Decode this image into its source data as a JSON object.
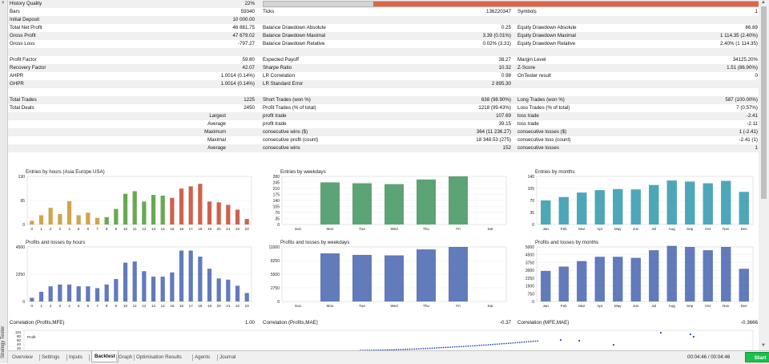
{
  "sidebar": {
    "vertical_label": "Strategy Tester",
    "close_glyph": "×"
  },
  "summary": {
    "progress_percent": 22,
    "rows": [
      {
        "alt": true,
        "cols": [
          [
            "History Quality",
            "22%"
          ],
          [
            "",
            ""
          ],
          [
            "",
            ""
          ]
        ]
      },
      {
        "alt": false,
        "cols": [
          [
            "Bars",
            "59340"
          ],
          [
            "Ticks",
            "136220347"
          ],
          [
            "Symbols",
            "1"
          ]
        ]
      },
      {
        "alt": true,
        "cols": [
          [
            "Initial Deposit",
            "10 000.00"
          ],
          [
            "",
            ""
          ],
          [
            "",
            ""
          ]
        ]
      },
      {
        "alt": false,
        "cols": [
          [
            "Total Net Profit",
            "46 881.75"
          ],
          [
            "Balance Drawdown Absolute",
            "0.25"
          ],
          [
            "Equity Drawdown Absolute",
            "66.89"
          ]
        ]
      },
      {
        "alt": true,
        "cols": [
          [
            "Gross Profit",
            "47 679.02"
          ],
          [
            "Balance Drawdown Maximal",
            "3.39 (0.01%)"
          ],
          [
            "Equity Drawdown Maximal",
            "1 114.35 (2.40%)"
          ]
        ]
      },
      {
        "alt": false,
        "cols": [
          [
            "Gross Loss",
            "-797.27"
          ],
          [
            "Balance Drawdown Relative",
            "0.02% (3.31)"
          ],
          [
            "Equity Drawdown Relative",
            "2.40% (1 114.35)"
          ]
        ]
      },
      {
        "alt": true,
        "cols": [
          [
            "",
            ""
          ],
          [
            "",
            ""
          ],
          [
            "",
            ""
          ]
        ]
      },
      {
        "alt": false,
        "cols": [
          [
            "Profit Factor",
            "59.80"
          ],
          [
            "Expected Payoff",
            "38.27"
          ],
          [
            "Margin Level",
            "34125.20%"
          ]
        ]
      },
      {
        "alt": true,
        "cols": [
          [
            "Recovery Factor",
            "42.07"
          ],
          [
            "Sharpe Ratio",
            "10.32"
          ],
          [
            "Z-Score",
            "1.51 (86.90%)"
          ]
        ]
      },
      {
        "alt": false,
        "cols": [
          [
            "AHPR",
            "1.0014 (0.14%)"
          ],
          [
            "LR Correlation",
            "0.98"
          ],
          [
            "OnTester result",
            "0"
          ]
        ]
      },
      {
        "alt": true,
        "cols": [
          [
            "GHPR",
            "1.0014 (0.14%)"
          ],
          [
            "LR Standard Error",
            "2 895.30"
          ],
          [
            "",
            ""
          ]
        ]
      },
      {
        "alt": false,
        "cols": [
          [
            "",
            ""
          ],
          [
            "",
            ""
          ],
          [
            "",
            ""
          ]
        ]
      },
      {
        "alt": true,
        "cols": [
          [
            "Total Trades",
            "1225"
          ],
          [
            "Short Trades (won %)",
            "638 (98.90%)"
          ],
          [
            "Long Trades (won %)",
            "587 (100.00%)"
          ]
        ]
      },
      {
        "alt": false,
        "cols": [
          [
            "Total Deals",
            "2450"
          ],
          [
            "Profit Trades (% of total)",
            "1218 (99.43%)"
          ],
          [
            "Loss Trades (% of total)",
            "7 (0.57%)"
          ]
        ]
      },
      {
        "alt": true,
        "cols": [
          [
            "Largest",
            "profit trade",
            "107.69"
          ],
          [
            "",
            "loss trade",
            "-2.41"
          ]
        ],
        "sub": true
      },
      {
        "alt": false,
        "cols": [
          [
            "Average",
            "profit trade",
            "39.15"
          ],
          [
            "",
            "loss trade",
            "-2.11"
          ]
        ],
        "sub": true
      },
      {
        "alt": true,
        "cols": [
          [
            "Maximum",
            "consecutive wins ($)",
            "364 (11 236.27)"
          ],
          [
            "",
            "consecutive losses ($)",
            "1 (-2.41)"
          ]
        ],
        "sub": true
      },
      {
        "alt": false,
        "cols": [
          [
            "Maximal",
            "consecutive profit (count)",
            "18 348.53 (275)"
          ],
          [
            "",
            "consecutive loss (count)",
            "-2.41 (1)"
          ]
        ],
        "sub": true
      },
      {
        "alt": true,
        "cols": [
          [
            "Average",
            "consecutive wins",
            "152"
          ],
          [
            "",
            "consecutive losses",
            "1"
          ]
        ],
        "sub": true
      }
    ]
  },
  "chart_data": [
    {
      "id": "entries-hours",
      "type": "bar",
      "title": "Entries by hours (Asia Europe USA)",
      "categories": [
        "0",
        "1",
        "2",
        "3",
        "4",
        "5",
        "6",
        "7",
        "8",
        "9",
        "10",
        "11",
        "12",
        "13",
        "14",
        "15",
        "16",
        "17",
        "18",
        "19",
        "20",
        "21",
        "22",
        "23"
      ],
      "values": [
        10,
        25,
        45,
        28,
        63,
        25,
        32,
        18,
        20,
        42,
        83,
        90,
        62,
        80,
        78,
        72,
        97,
        103,
        110,
        62,
        60,
        53,
        40,
        15
      ],
      "ylim": [
        0,
        130
      ],
      "yticks": [
        "130",
        "65",
        "0"
      ],
      "colors": [
        "#c8952c",
        "#c8952c",
        "#c8952c",
        "#c8952c",
        "#c8952c",
        "#c8952c",
        "#c8952c",
        "#c8952c",
        "#4e9a32",
        "#4e9a32",
        "#4e9a32",
        "#4e9a32",
        "#4e9a32",
        "#4e9a32",
        "#4e9a32",
        "#c4462e",
        "#c4462e",
        "#c4462e",
        "#c4462e",
        "#c4462e",
        "#c4462e",
        "#c4462e",
        "#c4462e",
        "#c4462e"
      ]
    },
    {
      "id": "entries-weekdays",
      "type": "bar",
      "title": "Entries by weekdays",
      "categories": [
        "Sun",
        "Mon",
        "Tue",
        "Wed",
        "Thu",
        "Fri",
        "Sat"
      ],
      "values": [
        0,
        245,
        240,
        235,
        262,
        280,
        0
      ],
      "ylim": [
        0,
        280
      ],
      "yticks": [
        "280",
        "245",
        "210",
        "175",
        "140",
        "105",
        "70",
        "35",
        "0"
      ],
      "colors": [
        "#2e8a4e"
      ]
    },
    {
      "id": "entries-months",
      "type": "bar",
      "title": "Entries by months",
      "categories": [
        "Jan",
        "Feb",
        "Mar",
        "Apr",
        "May",
        "Jun",
        "Jul",
        "Aug",
        "Sep",
        "Oct",
        "Nov",
        "Dec"
      ],
      "values": [
        70,
        80,
        93,
        100,
        103,
        102,
        115,
        128,
        125,
        120,
        127,
        95
      ],
      "ylim": [
        0,
        140
      ],
      "yticks": [
        "140",
        "105",
        "70",
        "35",
        "0"
      ],
      "colors": [
        "#1c8ea4"
      ]
    },
    {
      "id": "profits-hours",
      "type": "bar",
      "title": "Profits and losses by hours",
      "categories": [
        "0",
        "1",
        "2",
        "3",
        "4",
        "5",
        "6",
        "7",
        "8",
        "9",
        "10",
        "11",
        "12",
        "13",
        "14",
        "15",
        "16",
        "17",
        "18",
        "19",
        "20",
        "21",
        "22",
        "23"
      ],
      "values": [
        300,
        800,
        1250,
        1400,
        1400,
        1250,
        1250,
        1100,
        1400,
        1850,
        3200,
        3300,
        2500,
        2050,
        2050,
        2400,
        4200,
        4200,
        3700,
        2700,
        1900,
        1800,
        1300,
        700
      ],
      "ylim": [
        0,
        4500
      ],
      "yticks": [
        "4500",
        "2250",
        "0"
      ],
      "colors": [
        "#3456a8"
      ]
    },
    {
      "id": "profits-weekdays",
      "type": "bar",
      "title": "Profits and losses by weekdays",
      "categories": [
        "Sun",
        "Mon",
        "Tue",
        "Wed",
        "Thu",
        "Fri",
        "Sat"
      ],
      "values": [
        0,
        9700,
        9400,
        9300,
        10500,
        11000,
        0
      ],
      "ylim": [
        0,
        11000
      ],
      "yticks": [
        "11000",
        "8250",
        "5500",
        "2750",
        "0"
      ],
      "colors": [
        "#3456a8"
      ]
    },
    {
      "id": "profits-months",
      "type": "bar",
      "title": "Profits and losses by months",
      "categories": [
        "Jan",
        "Feb",
        "Mar",
        "Apr",
        "May",
        "Jun",
        "Jul",
        "Aug",
        "Sep",
        "Oct",
        "Nov",
        "Dec"
      ],
      "values": [
        2800,
        3200,
        3700,
        4100,
        4100,
        4000,
        4700,
        5100,
        5000,
        4700,
        5000,
        3000
      ],
      "ylim": [
        0,
        5000
      ],
      "yticks": [
        "5000",
        "4500",
        "3750",
        "3000",
        "2250",
        "1500",
        "750",
        "0"
      ],
      "colors": [
        "#3456a8"
      ]
    }
  ],
  "correlation": {
    "items": [
      {
        "label": "Correlation (Profits,MFE)",
        "value": "1.00"
      },
      {
        "label": "Correlation (Profits,MAE)",
        "value": "-0.37"
      },
      {
        "label": "Correlation (MFE,MAE)",
        "value": "-0.3666"
      }
    ]
  },
  "scatter": {
    "title": "Profit",
    "yticks": [
      "110",
      "80",
      "60",
      "40",
      "20"
    ]
  },
  "tabs": {
    "items": [
      "Overview",
      "Settings",
      "Inputs",
      "Backtest",
      "Graph",
      "Optimisation Results",
      "Agents",
      "Journal"
    ],
    "active_index": 3
  },
  "status": {
    "timer": "00:04:46 / 00:04:46",
    "start_label": "Start"
  }
}
